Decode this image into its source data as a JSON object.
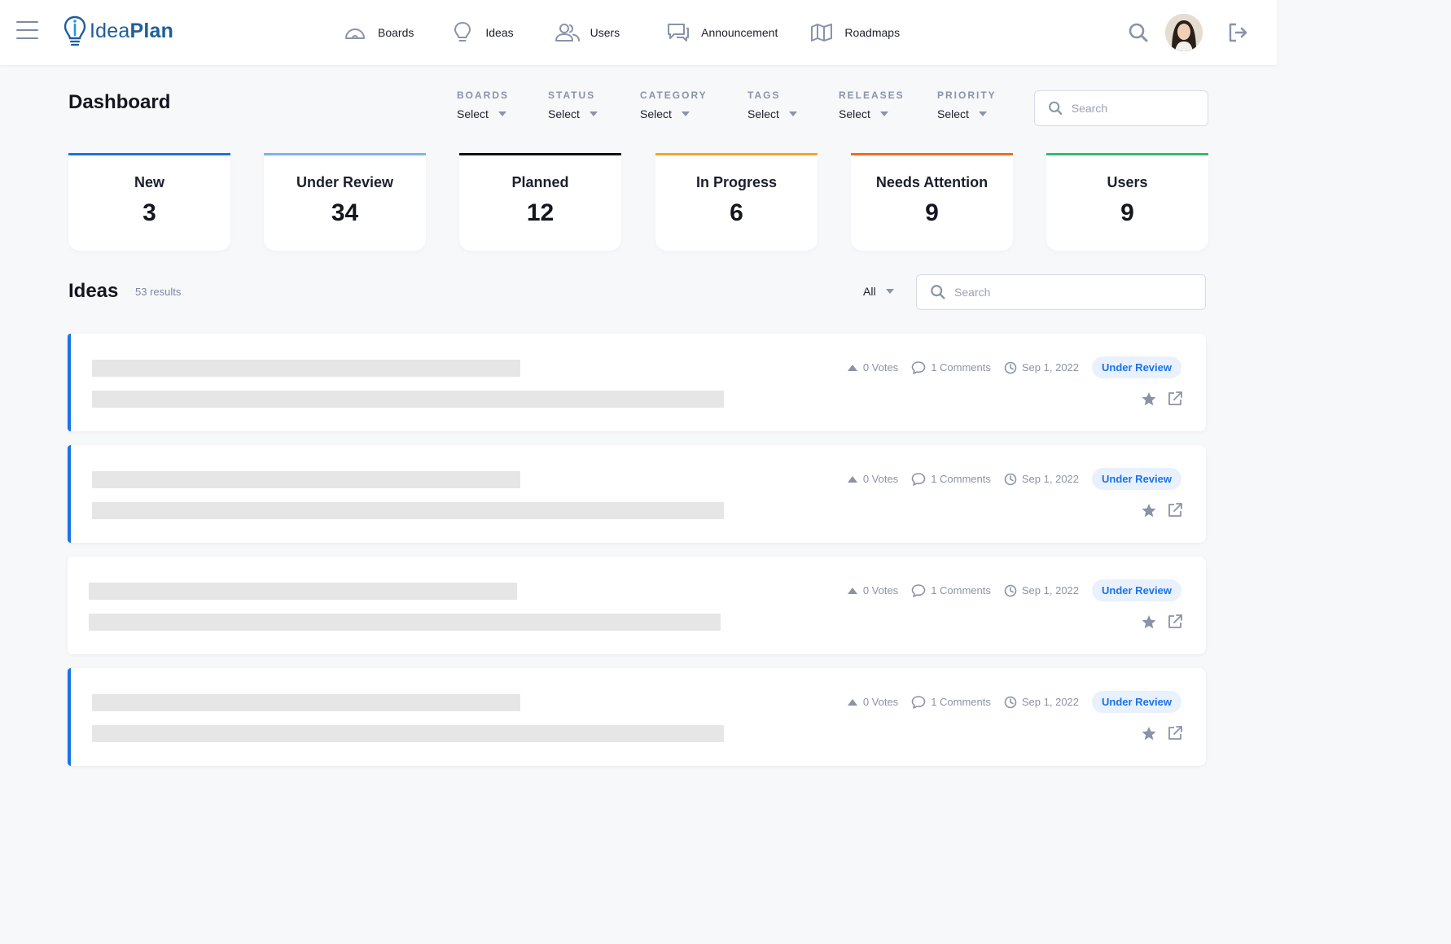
{
  "app": {
    "brand_part1": "Idea",
    "brand_part2": "Plan"
  },
  "nav": {
    "items": [
      {
        "label": "Boards",
        "icon": "gauge-icon"
      },
      {
        "label": "Ideas",
        "icon": "lightbulb-icon"
      },
      {
        "label": "Users",
        "icon": "users-icon"
      },
      {
        "label": "Announcement",
        "icon": "chat-bubbles-icon"
      },
      {
        "label": "Roadmaps",
        "icon": "map-icon"
      }
    ]
  },
  "dashboard": {
    "title": "Dashboard",
    "filters": [
      {
        "label": "BOARDS",
        "value": "Select"
      },
      {
        "label": "STATUS",
        "value": "Select"
      },
      {
        "label": "CATEGORY",
        "value": "Select"
      },
      {
        "label": "TAGS",
        "value": "Select"
      },
      {
        "label": "RELEASES",
        "value": "Select"
      },
      {
        "label": "PRIORITY",
        "value": "Select"
      }
    ],
    "search_placeholder": "Search"
  },
  "stats": [
    {
      "label": "New",
      "value": "3",
      "color": "#1a73e8"
    },
    {
      "label": "Under Review",
      "value": "34",
      "color": "#7fb2ee"
    },
    {
      "label": "Planned",
      "value": "12",
      "color": "#111111"
    },
    {
      "label": "In Progress",
      "value": "6",
      "color": "#f5a623"
    },
    {
      "label": "Needs Attention",
      "value": "9",
      "color": "#f36c21"
    },
    {
      "label": "Users",
      "value": "9",
      "color": "#2ebd6b"
    }
  ],
  "ideas": {
    "title": "Ideas",
    "count": "53 results",
    "filter_value": "All",
    "search_placeholder": "Search",
    "list": [
      {
        "votes": "0 Votes",
        "comments": "1 Comments",
        "date": "Sep 1, 2022",
        "status": "Under Review"
      },
      {
        "votes": "0 Votes",
        "comments": "1 Comments",
        "date": "Sep 1, 2022",
        "status": "Under Review"
      },
      {
        "votes": "0 Votes",
        "comments": "1 Comments",
        "date": "Sep 1, 2022",
        "status": "Under Review"
      },
      {
        "votes": "0 Votes",
        "comments": "1 Comments",
        "date": "Sep 1, 2022",
        "status": "Under Review"
      }
    ]
  },
  "colors": {
    "accent": "#1a73e8",
    "badge_bg": "#e8f1fd",
    "brand": "#1f5e9a"
  }
}
